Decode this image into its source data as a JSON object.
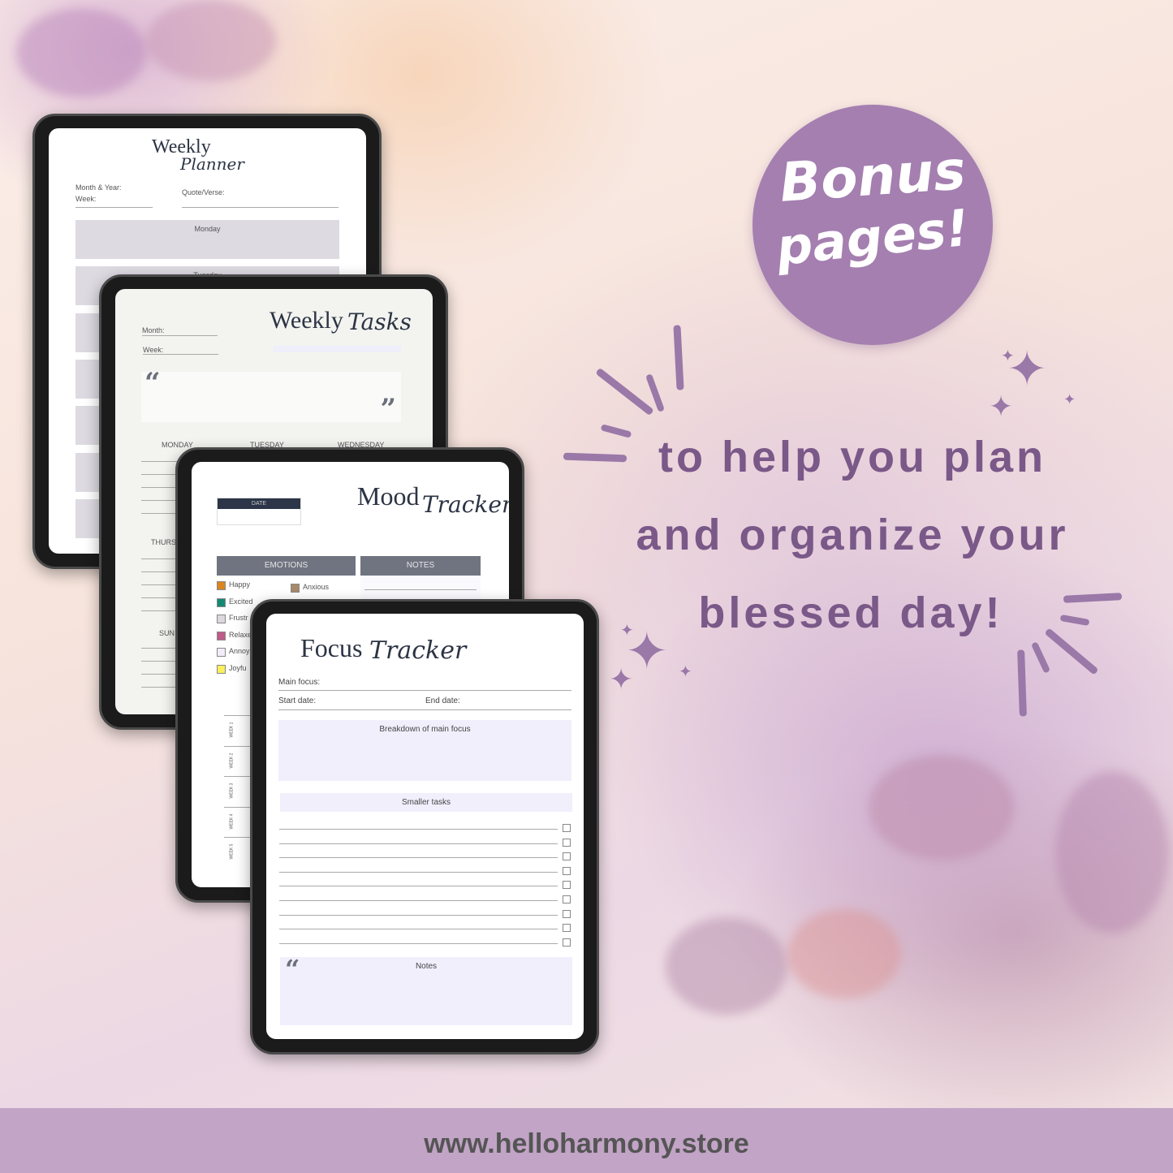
{
  "colors": {
    "accent": "#a47fb0",
    "headline": "#7a5888",
    "band": "#c2a4c6",
    "tablet_frame": "#1b1b1b",
    "header_gray": "#6f7480",
    "light_lavender": "#f0edfb"
  },
  "bonus": {
    "line1": "Bonus",
    "line2": "pages!"
  },
  "headline": {
    "line1": "to help you plan",
    "line2": "and organize your",
    "line3": "blessed day!"
  },
  "footer": {
    "url": "www.helloharmony.store"
  },
  "weekly_planner": {
    "title_a": "Weekly",
    "title_b": "Planner",
    "month_year": "Month & Year:",
    "week": "Week:",
    "quote": "Quote/Verse:",
    "days": [
      "Monday",
      "Tuesday"
    ]
  },
  "weekly_tasks": {
    "title_a": "Weekly",
    "title_b": "Tasks",
    "month": "Month:",
    "week": "Week:",
    "open_quote": "“",
    "close_quote": "”",
    "days": [
      "MONDAY",
      "TUESDAY",
      "WEDNESDAY",
      "THURS",
      "SUN"
    ]
  },
  "mood_tracker": {
    "title_a": "Mood",
    "title_b": "Tracker",
    "date": "DATE",
    "emotions": "EMOTIONS",
    "notes": "NOTES",
    "emotion_items": [
      {
        "label": "Happy",
        "color": "#d9861e"
      },
      {
        "label": "Excited",
        "color": "#128a73"
      },
      {
        "label": "Frustr",
        "color": "#dcd8dc"
      },
      {
        "label": "Relaxe",
        "color": "#c05a88"
      },
      {
        "label": "Annoy",
        "color": "#f0ecfa"
      },
      {
        "label": "Joyfu",
        "color": "#fbef5c"
      }
    ],
    "anxious": {
      "label": "Anxious",
      "color": "#a8896a"
    },
    "weeks": [
      "WEEK 1",
      "WEEK 2",
      "WEEK 3",
      "WEEK 4",
      "WEEK 5"
    ]
  },
  "focus_tracker": {
    "title_a": "Focus",
    "title_b": "Tracker",
    "main_focus": "Main focus:",
    "start_date": "Start date:",
    "end_date": "End date:",
    "breakdown": "Breakdown of main focus",
    "smaller_tasks": "Smaller tasks",
    "notes": "Notes",
    "open_quote": "“"
  }
}
